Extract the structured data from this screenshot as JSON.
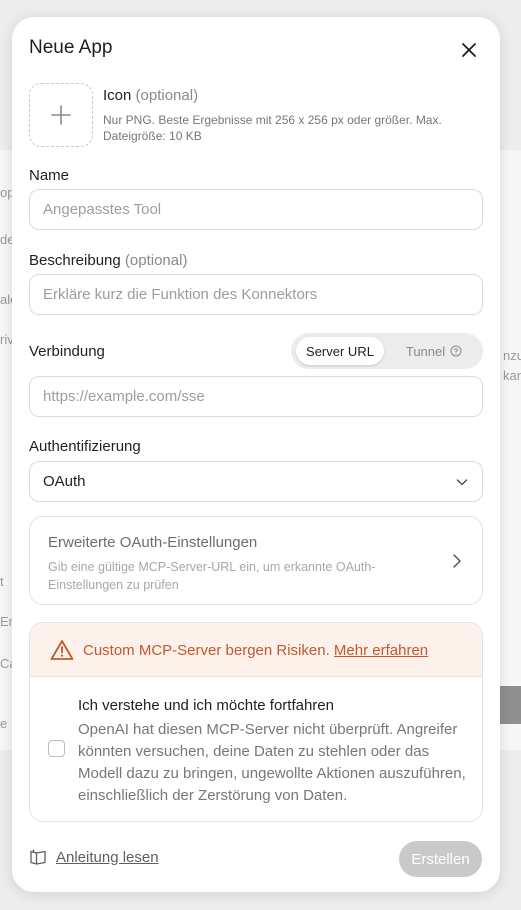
{
  "background": {
    "fragments": [
      "ope",
      "de",
      "ale",
      "riv",
      "t",
      "Em",
      "Ca",
      "e",
      "nzu",
      "kar"
    ]
  },
  "modal": {
    "title": "Neue App",
    "close_icon": "close-icon"
  },
  "icon_upload": {
    "label": "Icon",
    "optional": "(optional)",
    "help": "Nur PNG. Beste Ergebnisse mit 256 x 256 px oder größer. Max. Dateigröße: 10 KB",
    "icon": "plus-icon"
  },
  "name": {
    "label": "Name",
    "value": "",
    "placeholder": "Angepasstes Tool"
  },
  "description": {
    "label": "Beschreibung",
    "optional": "(optional)",
    "value": "",
    "placeholder": "Erkläre kurz die Funktion des Konnektors"
  },
  "connection": {
    "label": "Verbindung",
    "options": [
      "Server URL",
      "Tunnel"
    ],
    "selected": "Server URL",
    "url_value": "",
    "url_placeholder": "https://example.com/sse"
  },
  "auth": {
    "label": "Authentifizierung",
    "selected": "OAuth"
  },
  "advanced": {
    "title": "Erweiterte OAuth-Einstellungen",
    "description": "Gib eine gültige MCP-Server-URL ein, um erkannte OAuth-Einstellungen zu prüfen"
  },
  "risk": {
    "warning": "Custom MCP-Server bergen Risiken.",
    "link": "Mehr erfahren",
    "consent_title": "Ich verstehe und ich möchte fortfahren",
    "consent_body": "OpenAI hat diesen MCP-Server nicht überprüft. Angreifer könnten versuchen, deine Daten zu stehlen oder das Modell dazu zu bringen, ungewollte Aktionen auszuführen, einschließlich der Zerstörung von Daten.",
    "checked": false
  },
  "footer": {
    "guide_label": "Anleitung lesen",
    "create_label": "Erstellen"
  },
  "colors": {
    "warning": "#c4582a",
    "warning_bg": "#fdf1ec",
    "disabled_button": "#c9c9c9"
  }
}
